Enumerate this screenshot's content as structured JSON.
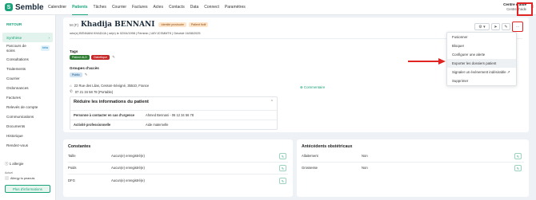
{
  "nav": {
    "logo_letter": "S",
    "logo": "Semble",
    "items": [
      "Calendrier",
      "Patients",
      "Tâches",
      "Courrier",
      "Factures",
      "Actes",
      "Contacts",
      "Data",
      "Connect",
      "Paramètres"
    ],
    "center_name": "Centre d'aide",
    "center_sub": "Centre d'aide"
  },
  "sidebar": {
    "back": "RETOUR",
    "items": [
      "Synthèse",
      "Parcours de soins",
      "Consultations",
      "Traitements",
      "Courrier",
      "Ordonnances",
      "Factures",
      "Relevés de compte",
      "Communications",
      "Documents",
      "Historique",
      "Rendez-vous"
    ],
    "beta": "bêta",
    "allergy_count": "1 allergie",
    "actuel": "Actuel",
    "allergy_name": "Allergy to peanuts",
    "more_info": "Plus d'informations"
  },
  "patient": {
    "civility": "M (F)",
    "name": "Khadija BENNANI",
    "badge_provisional": "Identité provisoire",
    "badge_fictitious": "Patient fictif",
    "meta": "née(e) BENNANI KHADIJA  |  né(e) le 02/04/1998  |  Féminin  |  U8YJCSMMTK  |  Décédé 16/08/2025",
    "tags_title": "Tags",
    "tags": [
      "Patient ALD",
      "Diabétique"
    ],
    "groups_title": "Groupes d'accès",
    "groups": [
      "Public"
    ],
    "address": "22 Rue des Lilas, Cesson-Sévigné, 35510, France",
    "phone": "07 21 34 58 78 (Portable)",
    "comment": "Commentaire",
    "reduce_title": "Réduire les informations du patient",
    "info_rows": [
      {
        "label": "Personne à contacter en cas d'urgence",
        "value": "Ahmed Bennani - 06 12 34 56 78"
      },
      {
        "label": "Activité professionnelle",
        "value": "Aide maternelle"
      }
    ]
  },
  "actions": {
    "share_icon": "⚙ ▾",
    "send_icon": "➤",
    "edit_icon": "✎",
    "more_icon": "⋯"
  },
  "dropdown": {
    "items": [
      "Fusionner",
      "Bloquer",
      "Configurer une alerte",
      "Exporter les dossiers patient",
      "Signaler un événement indésirable ↗",
      "Supprimer"
    ]
  },
  "constantes": {
    "title": "Constantes",
    "rows": [
      {
        "label": "Taille",
        "value": "Aucun(e) enregistré(e)"
      },
      {
        "label": "Poids",
        "value": "Aucun(e) enregistré(e)"
      },
      {
        "label": "DFG",
        "value": "Aucun(e) enregistré(e)"
      }
    ]
  },
  "obstetric": {
    "title": "Antécédents obstétricaux",
    "rows": [
      {
        "label": "Allaitement",
        "value": "Non"
      },
      {
        "label": "Grossesse",
        "value": "Non"
      }
    ]
  },
  "colors": {
    "accent": "#1aa37a",
    "highlight": "#e02424"
  }
}
